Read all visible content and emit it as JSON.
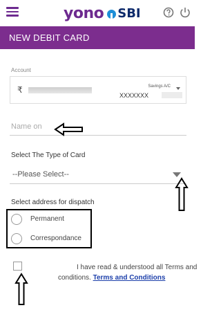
{
  "header": {
    "brand_yono": "yono",
    "brand_sbi": "SBI",
    "icons": [
      "menu-icon",
      "help-icon",
      "power-icon"
    ]
  },
  "titlebar": {
    "title": "NEW DEBIT CARD"
  },
  "account": {
    "label": "Account",
    "currency_symbol": "₹",
    "account_type": "Savings A/C",
    "account_number": "XXXXXXX"
  },
  "name_field": {
    "placeholder": "Name on"
  },
  "card_type": {
    "label": "Select The Type of Card",
    "selected": "--Please Select--"
  },
  "dispatch": {
    "label": "Select address for dispatch",
    "options": [
      "Permanent",
      "Correspondance"
    ]
  },
  "terms": {
    "line1": "I have read & understood all Terms and",
    "line2_prefix": "conditions.",
    "link": "Terms and Conditions"
  },
  "colors": {
    "brand_purple": "#7c2d8e",
    "link_blue": "#1c3faa",
    "sbi_blue": "#1e8fd8"
  }
}
